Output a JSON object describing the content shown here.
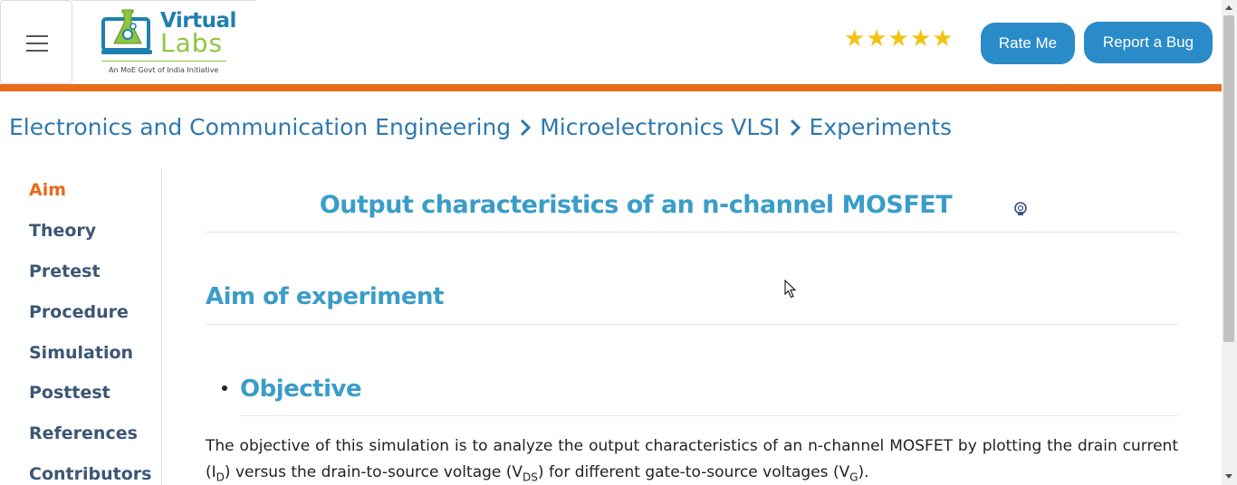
{
  "header": {
    "logo": {
      "word1": "Virtual",
      "word2": "Labs",
      "tagline": "An MoE Govt of India Initiative"
    },
    "rating_stars": 5,
    "rate_button": "Rate Me",
    "bug_button": "Report a Bug",
    "colors": {
      "accent_blue": "#2a8bc9",
      "accent_orange": "#ea6a17",
      "star": "#f3c313"
    }
  },
  "breadcrumb": {
    "items": [
      "Electronics and Communication Engineering",
      "Microelectronics VLSI",
      "Experiments"
    ],
    "separator_icon": "chevron-right-icon"
  },
  "sidebar": {
    "items": [
      {
        "label": "Aim",
        "active": true
      },
      {
        "label": "Theory",
        "active": false
      },
      {
        "label": "Pretest",
        "active": false
      },
      {
        "label": "Procedure",
        "active": false
      },
      {
        "label": "Simulation",
        "active": false
      },
      {
        "label": "Posttest",
        "active": false
      },
      {
        "label": "References",
        "active": false
      },
      {
        "label": "Contributors",
        "active": false
      }
    ]
  },
  "main": {
    "title": "Output characteristics of an n-channel MOSFET",
    "aim_heading": "Aim of experiment",
    "objective_heading": "Objective",
    "objective_text": {
      "t1": "The objective of this simulation is to analyze the output characteristics of an n-channel MOSFET by plotting the drain current (I",
      "s1": "D",
      "t2": ") versus the drain-to-source voltage (V",
      "s2": "DS",
      "t3": ") for different gate-to-source voltages (V",
      "s3": "G",
      "t4": ")."
    }
  }
}
